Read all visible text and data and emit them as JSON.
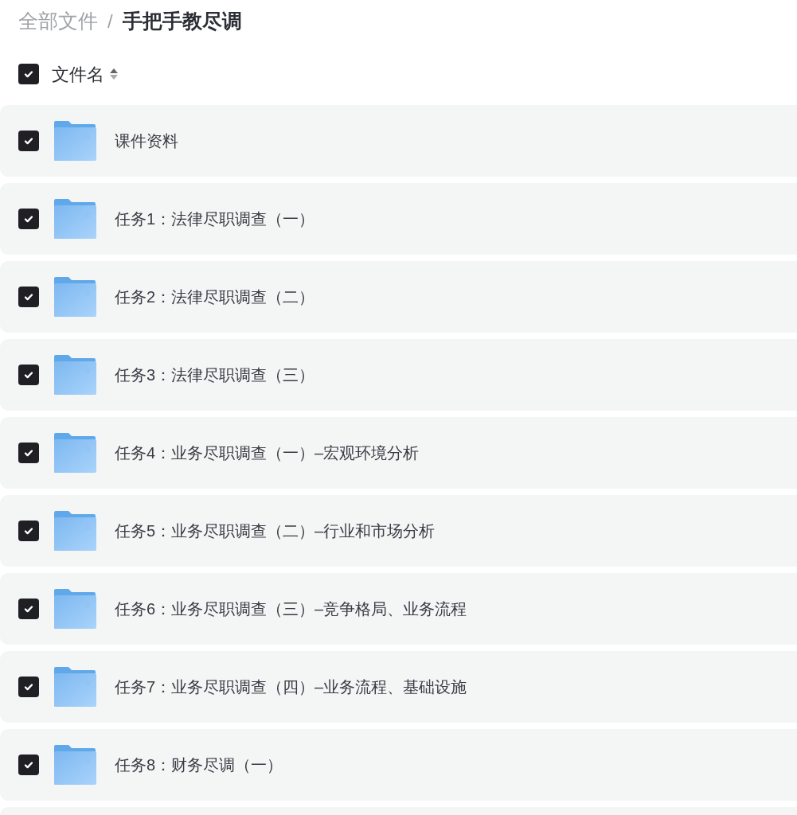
{
  "breadcrumb": [
    {
      "label": "全部文件",
      "current": false
    },
    {
      "label": "手把手教尽调",
      "current": true
    }
  ],
  "breadcrumb_separator": "/",
  "header": {
    "label": "文件名",
    "checked": true
  },
  "files": [
    {
      "name": "课件资料",
      "checked": true
    },
    {
      "name": "任务1：法律尽职调查（一）",
      "checked": true
    },
    {
      "name": "任务2：法律尽职调查（二）",
      "checked": true
    },
    {
      "name": "任务3：法律尽职调查（三）",
      "checked": true
    },
    {
      "name": "任务4：业务尽职调查（一）–宏观环境分析",
      "checked": true
    },
    {
      "name": "任务5：业务尽职调查（二）–行业和市场分析",
      "checked": true
    },
    {
      "name": "任务6：业务尽职调查（三）–竞争格局、业务流程",
      "checked": true
    },
    {
      "name": "任务7：业务尽职调查（四）–业务流程、基础设施",
      "checked": true
    },
    {
      "name": "任务8：财务尽调（一）",
      "checked": true
    }
  ]
}
